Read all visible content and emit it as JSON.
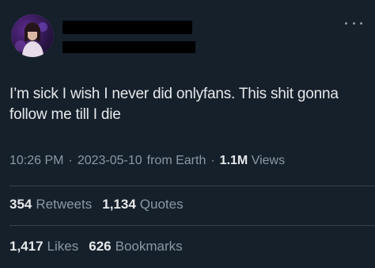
{
  "tweet": {
    "text": "I’m sick I wish I never did onlyfans. This shit gonna follow me till I die",
    "time": "10:26 PM",
    "date": "2023-05-10",
    "source": "from Earth",
    "separator": "·",
    "views_count": "1.1M",
    "views_label": "Views"
  },
  "stats": {
    "retweets": {
      "count": "354",
      "label": "Retweets"
    },
    "quotes": {
      "count": "1,134",
      "label": "Quotes"
    },
    "likes": {
      "count": "1,417",
      "label": "Likes"
    },
    "bookmarks": {
      "count": "626",
      "label": "Bookmarks"
    }
  },
  "icons": {
    "more": "more-horizontal-icon"
  },
  "colors": {
    "background": "#15202b",
    "text_primary": "#e7e9ea",
    "text_secondary": "#8b98a5",
    "divider": "#38444d"
  }
}
